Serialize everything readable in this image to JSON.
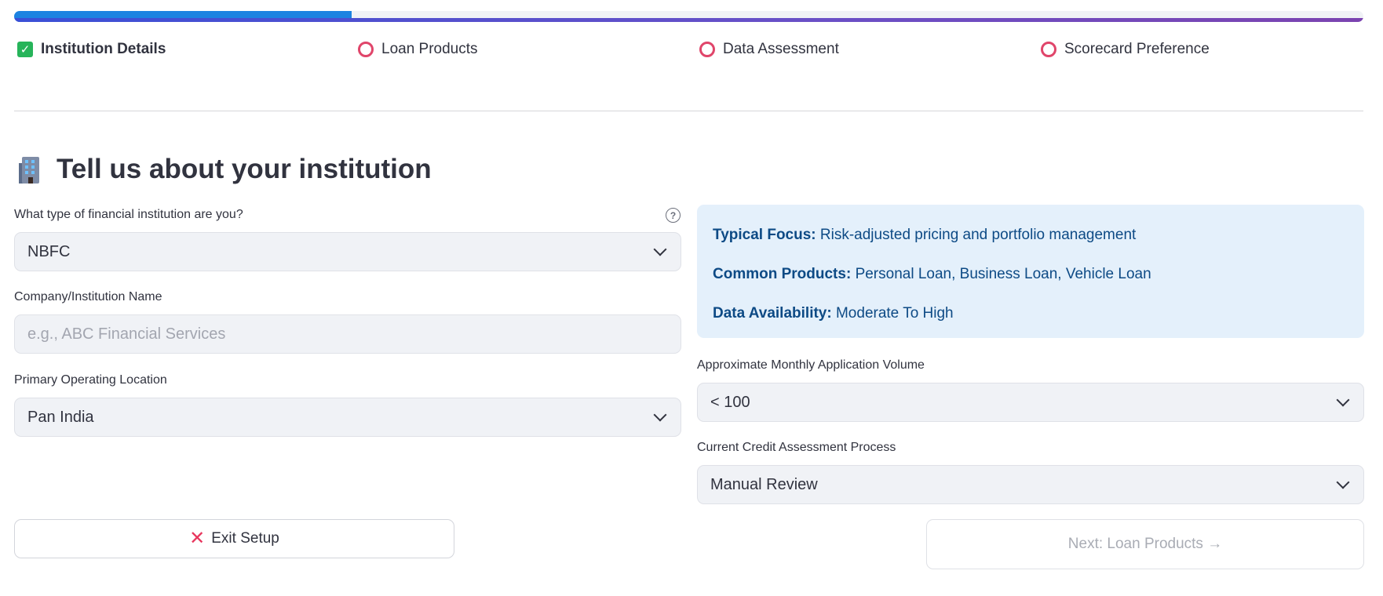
{
  "progress": {
    "fraction": 0.25,
    "fill_color": "#1c83e1"
  },
  "steps": [
    {
      "label": "Institution Details",
      "status": "complete"
    },
    {
      "label": "Loan Products",
      "status": "pending"
    },
    {
      "label": "Data Assessment",
      "status": "pending"
    },
    {
      "label": "Scorecard Preference",
      "status": "pending"
    }
  ],
  "page": {
    "title": "Tell us about your institution",
    "icon": "building-icon"
  },
  "form": {
    "institution_type": {
      "label": "What type of financial institution are you?",
      "value": "NBFC",
      "help": "?"
    },
    "company_name": {
      "label": "Company/Institution Name",
      "placeholder": "e.g., ABC Financial Services",
      "value": ""
    },
    "location": {
      "label": "Primary Operating Location",
      "value": "Pan India"
    },
    "monthly_volume": {
      "label": "Approximate Monthly Application Volume",
      "value": "< 100"
    },
    "assessment_process": {
      "label": "Current Credit Assessment Process",
      "value": "Manual Review"
    }
  },
  "info": {
    "focus_label": "Typical Focus:",
    "focus_value": "Risk-adjusted pricing and portfolio management",
    "products_label": "Common Products:",
    "products_value": "Personal Loan, Business Loan, Vehicle Loan",
    "data_label": "Data Availability:",
    "data_value": "Moderate To High"
  },
  "buttons": {
    "exit": "Exit Setup",
    "next": "Next: Loan Products →"
  },
  "colors": {
    "pending_ring": "#e0456a",
    "complete_check": "#27b45a",
    "info_bg": "#e4f0fb",
    "info_text": "#0d4a85"
  }
}
